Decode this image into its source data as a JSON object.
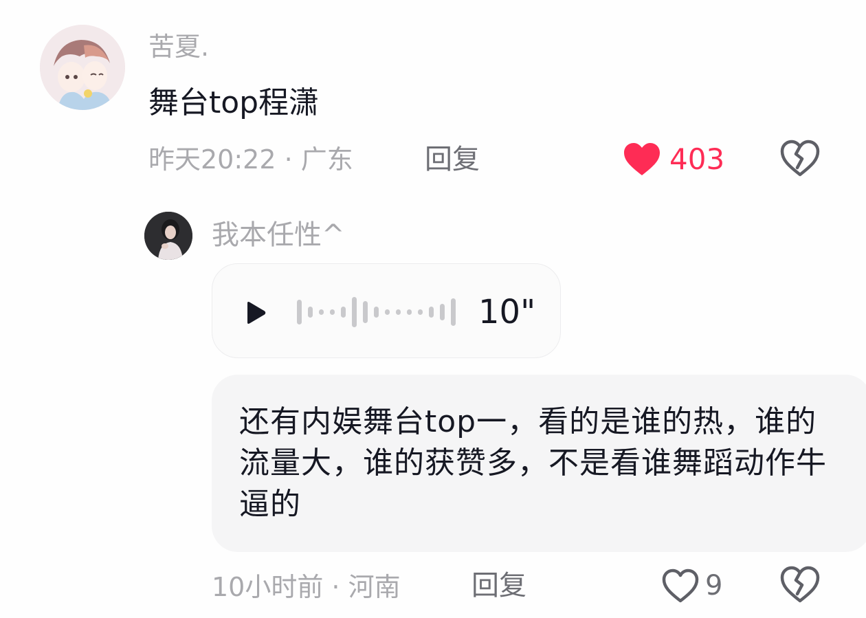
{
  "main_comment": {
    "username": "苦夏.",
    "text": "舞台top程潇",
    "meta": "昨天20:22 · 广东",
    "reply_label": "回复",
    "like_count": "403",
    "liked": true
  },
  "reply": {
    "username": "我本任性^",
    "voice_duration": "10\"",
    "text": "还有内娱舞台top一，看的是谁的热，谁的流量大，谁的获赞多，不是看谁舞蹈动作牛逼的",
    "meta": "10小时前 · 河南",
    "reply_label": "回复",
    "like_count": "9",
    "liked": false
  },
  "colors": {
    "like_active": "#fe2c55",
    "secondary_text": "#a9a9ad",
    "primary_text": "#161823",
    "bubble_bg": "#f5f5f6"
  },
  "icons": {
    "like_active": "heart-filled-icon",
    "like_inactive": "heart-outline-icon",
    "dislike": "broken-heart-icon",
    "play": "play-icon"
  }
}
